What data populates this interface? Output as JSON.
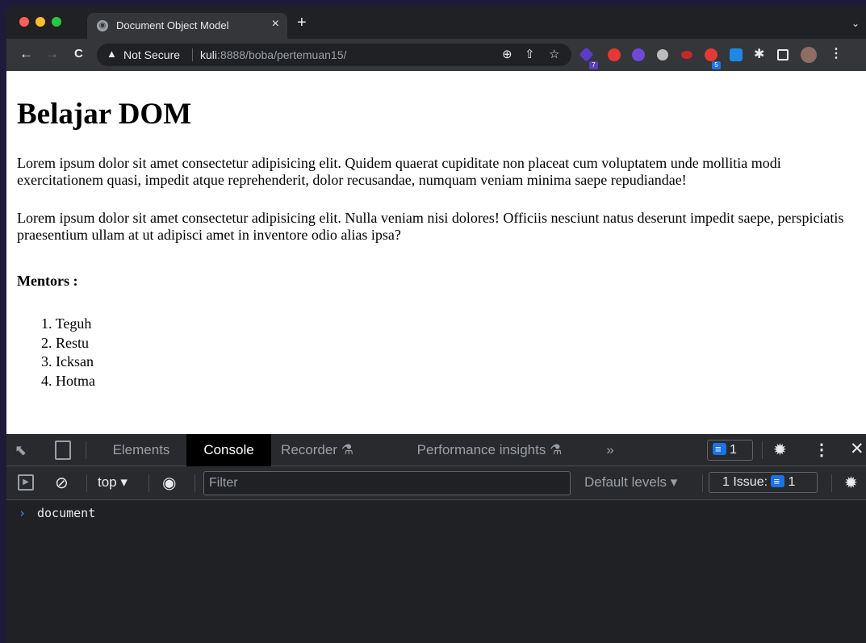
{
  "browser": {
    "tab": {
      "title": "Document Object Model",
      "close": "×"
    },
    "new_tab": "+",
    "tab_menu": "⌄",
    "nav": {
      "back": "←",
      "forward": "→",
      "reload": "C"
    },
    "omnibox": {
      "security": "Not Secure",
      "host": "kuli",
      "url_rest": ":8888/boba/pertemuan15/"
    },
    "extension_badges": [
      "7",
      "5"
    ],
    "colors": {
      "close": "#ff5f57",
      "minimize": "#febc2e",
      "maximize": "#28c840"
    }
  },
  "page": {
    "heading": "Belajar DOM",
    "paragraphs": [
      "Lorem ipsum dolor sit amet consectetur adipisicing elit. Quidem quaerat cupiditate non placeat cum voluptatem unde mollitia modi exercitationem quasi, impedit atque reprehenderit, dolor recusandae, numquam veniam minima saepe repudiandae!",
      "Lorem ipsum dolor sit amet consectetur adipisicing elit. Nulla veniam nisi dolores! Officiis nesciunt natus deserunt impedit saepe, perspiciatis praesentium ullam at ut adipisci amet in inventore odio alias ipsa?"
    ],
    "mentors_title": "Mentors :",
    "mentors": [
      "1. Teguh",
      "2. Restu",
      "3. Icksan",
      "4. Hotma"
    ]
  },
  "devtools": {
    "tabs": [
      "Elements",
      "Console",
      "Recorder",
      "Performance insights",
      "»"
    ],
    "active_tab": "Console",
    "message_count": "1",
    "context": "top",
    "filter_placeholder": "Filter",
    "levels": "Default levels",
    "issues_label": "1 Issue:",
    "issues_count": "1",
    "console_input": "document"
  }
}
